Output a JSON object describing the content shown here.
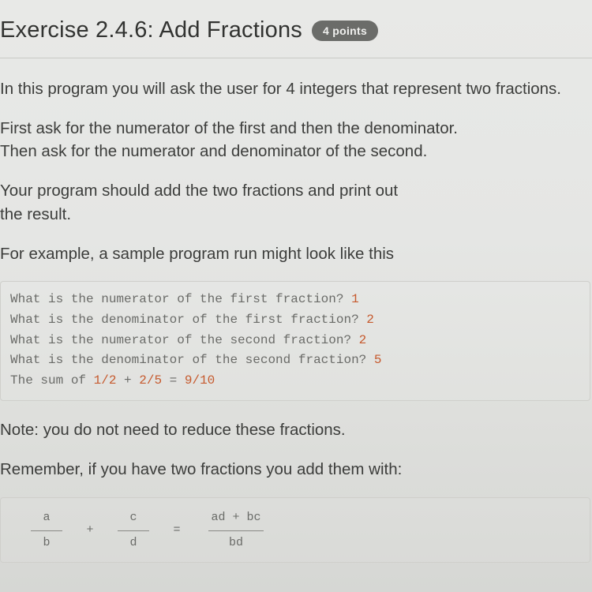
{
  "header": {
    "title": "Exercise 2.4.6: Add Fractions",
    "badge": "4 points"
  },
  "paragraphs": {
    "p1": "In this program you will ask the user for 4 integers that represent two fractions.",
    "p2a": "First ask for the numerator of the first and then the denominator.",
    "p2b": "Then ask for the numerator and denominator of the second.",
    "p3a": "Your program should add the two fractions and print out",
    "p3b": "the result.",
    "p4": "For example, a sample program run might look like this",
    "p5": "Note: you do not need to reduce these fractions.",
    "p6": "Remember, if you have two fractions you add them with:"
  },
  "code": {
    "l1": {
      "text": "What is the numerator of the first fraction? ",
      "val": "1"
    },
    "l2": {
      "text": "What is the denominator of the first fraction? ",
      "val": "2"
    },
    "l3": {
      "text": "What is the numerator of the second fraction? ",
      "val": "2"
    },
    "l4": {
      "text": "What is the denominator of the second fraction? ",
      "val": "5"
    },
    "l5": {
      "pre": "The sum of ",
      "f1": "1/2",
      "mid": " + ",
      "f2": "2/5",
      "eq": " = ",
      "res": "9/10"
    }
  },
  "formula": {
    "a": "a",
    "b": "b",
    "c": "c",
    "d": "d",
    "plus": "+",
    "eq": "=",
    "top": "ad + bc",
    "bot": "bd"
  }
}
